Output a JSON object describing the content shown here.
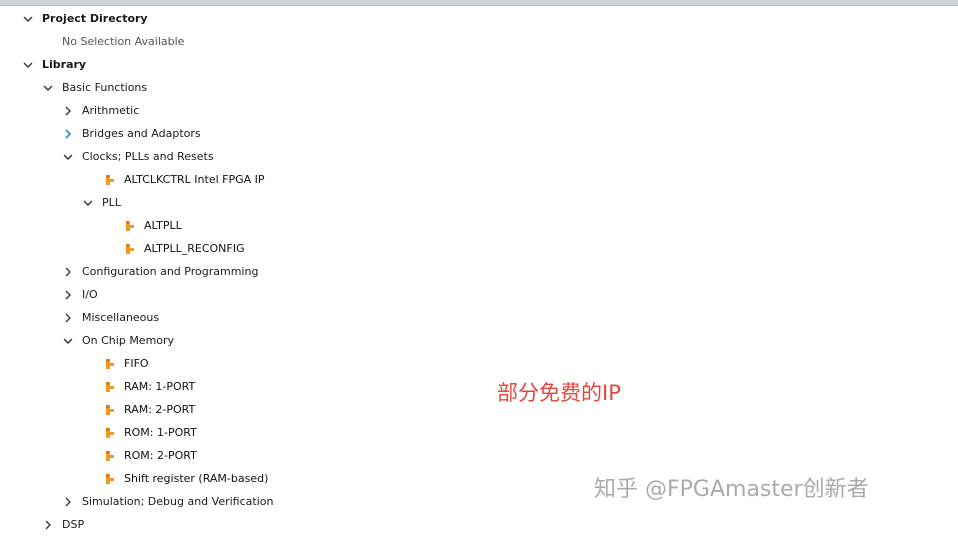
{
  "tree": {
    "project_directory": "Project Directory",
    "no_selection": "No Selection Available",
    "library": "Library",
    "basic_functions": "Basic Functions",
    "arithmetic": "Arithmetic",
    "bridges": "Bridges and Adaptors",
    "clocks": "Clocks; PLLs and Resets",
    "altclkctrl": "ALTCLKCTRL Intel FPGA IP",
    "pll": "PLL",
    "altpll": "ALTPLL",
    "altpll_reconfig": "ALTPLL_RECONFIG",
    "configuration": "Configuration and Programming",
    "io": "I/O",
    "miscellaneous": "Miscellaneous",
    "on_chip_memory": "On Chip Memory",
    "fifo": "FIFO",
    "ram1": "RAM: 1-PORT",
    "ram2": "RAM: 2-PORT",
    "rom1": "ROM: 1-PORT",
    "rom2": "ROM: 2-PORT",
    "shift_register": "Shift register (RAM-based)",
    "simulation": "Simulation; Debug and Verification",
    "dsp": "DSP"
  },
  "annotation": "部分免费的IP",
  "watermark": "知乎 @FPGAmaster创新者",
  "colors": {
    "ip_icon": "#f39a1e",
    "annotation": "#e0483f",
    "expander_blue": "#1a8fd8"
  },
  "icons": {
    "expanded": "chevron-down-icon",
    "collapsed": "chevron-right-icon",
    "ip_core": "ip-core-icon"
  }
}
